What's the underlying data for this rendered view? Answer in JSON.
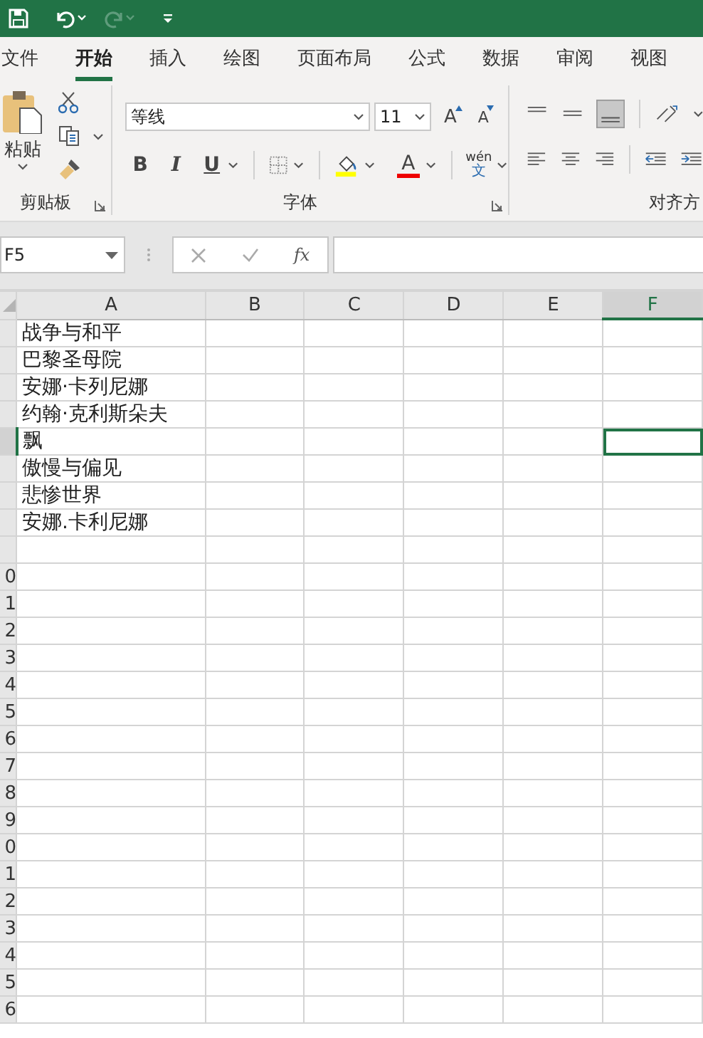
{
  "tabs": [
    {
      "label": "文件",
      "selected": false
    },
    {
      "label": "开始",
      "selected": true
    },
    {
      "label": "插入",
      "selected": false
    },
    {
      "label": "绘图",
      "selected": false
    },
    {
      "label": "页面布局",
      "selected": false
    },
    {
      "label": "公式",
      "selected": false
    },
    {
      "label": "数据",
      "selected": false
    },
    {
      "label": "审阅",
      "selected": false
    },
    {
      "label": "视图",
      "selected": false
    }
  ],
  "ribbon": {
    "clipboard": {
      "label": "剪贴板",
      "paste_label": "粘贴"
    },
    "font": {
      "label": "字体",
      "font_name": "等线",
      "font_size": "11",
      "grow_label": "A",
      "shrink_label": "A",
      "bold_label": "B",
      "italic_label": "I",
      "underline_label": "U",
      "color_label": "A",
      "phonetic_top": "wén",
      "phonetic_bottom": "文"
    },
    "alignment": {
      "label": "对齐方"
    }
  },
  "formula_bar": {
    "name_box": "F5",
    "function_label": "fx"
  },
  "sheet": {
    "columns": [
      {
        "label": "A",
        "selected": false
      },
      {
        "label": "B",
        "selected": false
      },
      {
        "label": "C",
        "selected": false
      },
      {
        "label": "D",
        "selected": false
      },
      {
        "label": "E",
        "selected": false
      },
      {
        "label": "F",
        "selected": true
      }
    ],
    "rows": [
      {
        "cell_a": "战争与和平",
        "selected": false
      },
      {
        "cell_a": "巴黎圣母院",
        "selected": false
      },
      {
        "cell_a": "安娜·卡列尼娜",
        "selected": false
      },
      {
        "cell_a": "约翰·克利斯朵夫",
        "selected": false
      },
      {
        "cell_a": "飘",
        "selected": true
      },
      {
        "cell_a": "傲慢与偏见",
        "selected": false
      },
      {
        "cell_a": "悲惨世界",
        "selected": false
      },
      {
        "cell_a": "安娜.卡利尼娜",
        "selected": false
      },
      {
        "selected": false
      },
      {
        "header": "0",
        "selected": false
      },
      {
        "header": "1",
        "selected": false
      },
      {
        "header": "2",
        "selected": false
      },
      {
        "header": "3",
        "selected": false
      },
      {
        "header": "4",
        "selected": false
      },
      {
        "header": "5",
        "selected": false
      },
      {
        "header": "6",
        "selected": false
      },
      {
        "header": "7",
        "selected": false
      },
      {
        "header": "8",
        "selected": false
      },
      {
        "header": "9",
        "selected": false
      },
      {
        "header": "0",
        "selected": false
      },
      {
        "header": "1",
        "selected": false
      },
      {
        "header": "2",
        "selected": false
      },
      {
        "header": "3",
        "selected": false
      },
      {
        "header": "4",
        "selected": false
      },
      {
        "header": "5",
        "selected": false
      },
      {
        "header": "6",
        "selected": false
      }
    ]
  }
}
